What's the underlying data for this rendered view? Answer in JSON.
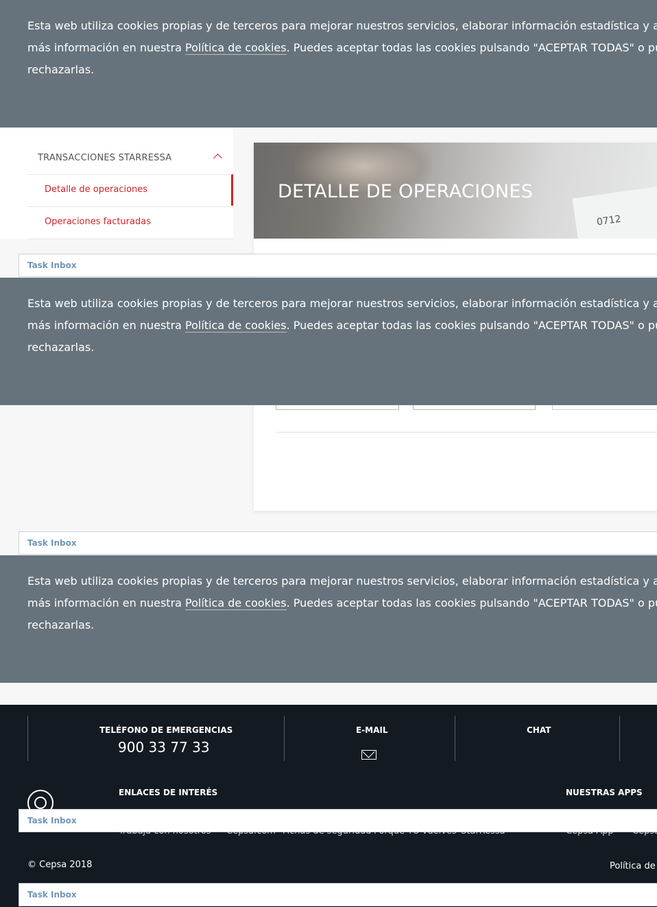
{
  "cookie": {
    "line1": "Esta web utiliza cookies propias y de terceros para mejorar nuestros servicios, elaborar información estadística y analizar tu",
    "line2_prefix": "más información en nuestra ",
    "policy_link": "Política de cookies",
    "line2_suffix": ". Puedes aceptar todas las cookies pulsando \"ACEPTAR TODAS\" o pulsar \"CO",
    "line3": "rechazarlas."
  },
  "task_inbox": {
    "label": "Task Inbox"
  },
  "sidebar": {
    "section_title": "TRANSACCIONES STARRESSA",
    "items": [
      {
        "label": "Detalle de operaciones"
      },
      {
        "label": "Operaciones facturadas"
      }
    ]
  },
  "main": {
    "title": "DETALLE DE OPERACIONES",
    "hero_number": "0712"
  },
  "footer": {
    "emergency_title": "TELÉFONO DE EMERGENCIAS",
    "emergency_phone": "900 33 77 33",
    "email_title": "E-MAIL",
    "chat_title": "CHAT",
    "links_title": "ENLACES DE INTERÉS",
    "apps_title": "NUESTRAS APPS",
    "links": [
      "Trabaja con nosotros",
      "Cepsa.com",
      "Fichas de seguridad",
      "Porque TÚ vuelves",
      "StarRessa"
    ],
    "apps": [
      "Cepsa App",
      "Cepsa"
    ],
    "copyright": "© Cepsa 2018",
    "right_link": "Política de C"
  },
  "colors": {
    "cookie_bg": "#67737c",
    "accent_red": "#d2232a",
    "footer_bg": "#131a21",
    "task_text": "#6f95b7"
  }
}
